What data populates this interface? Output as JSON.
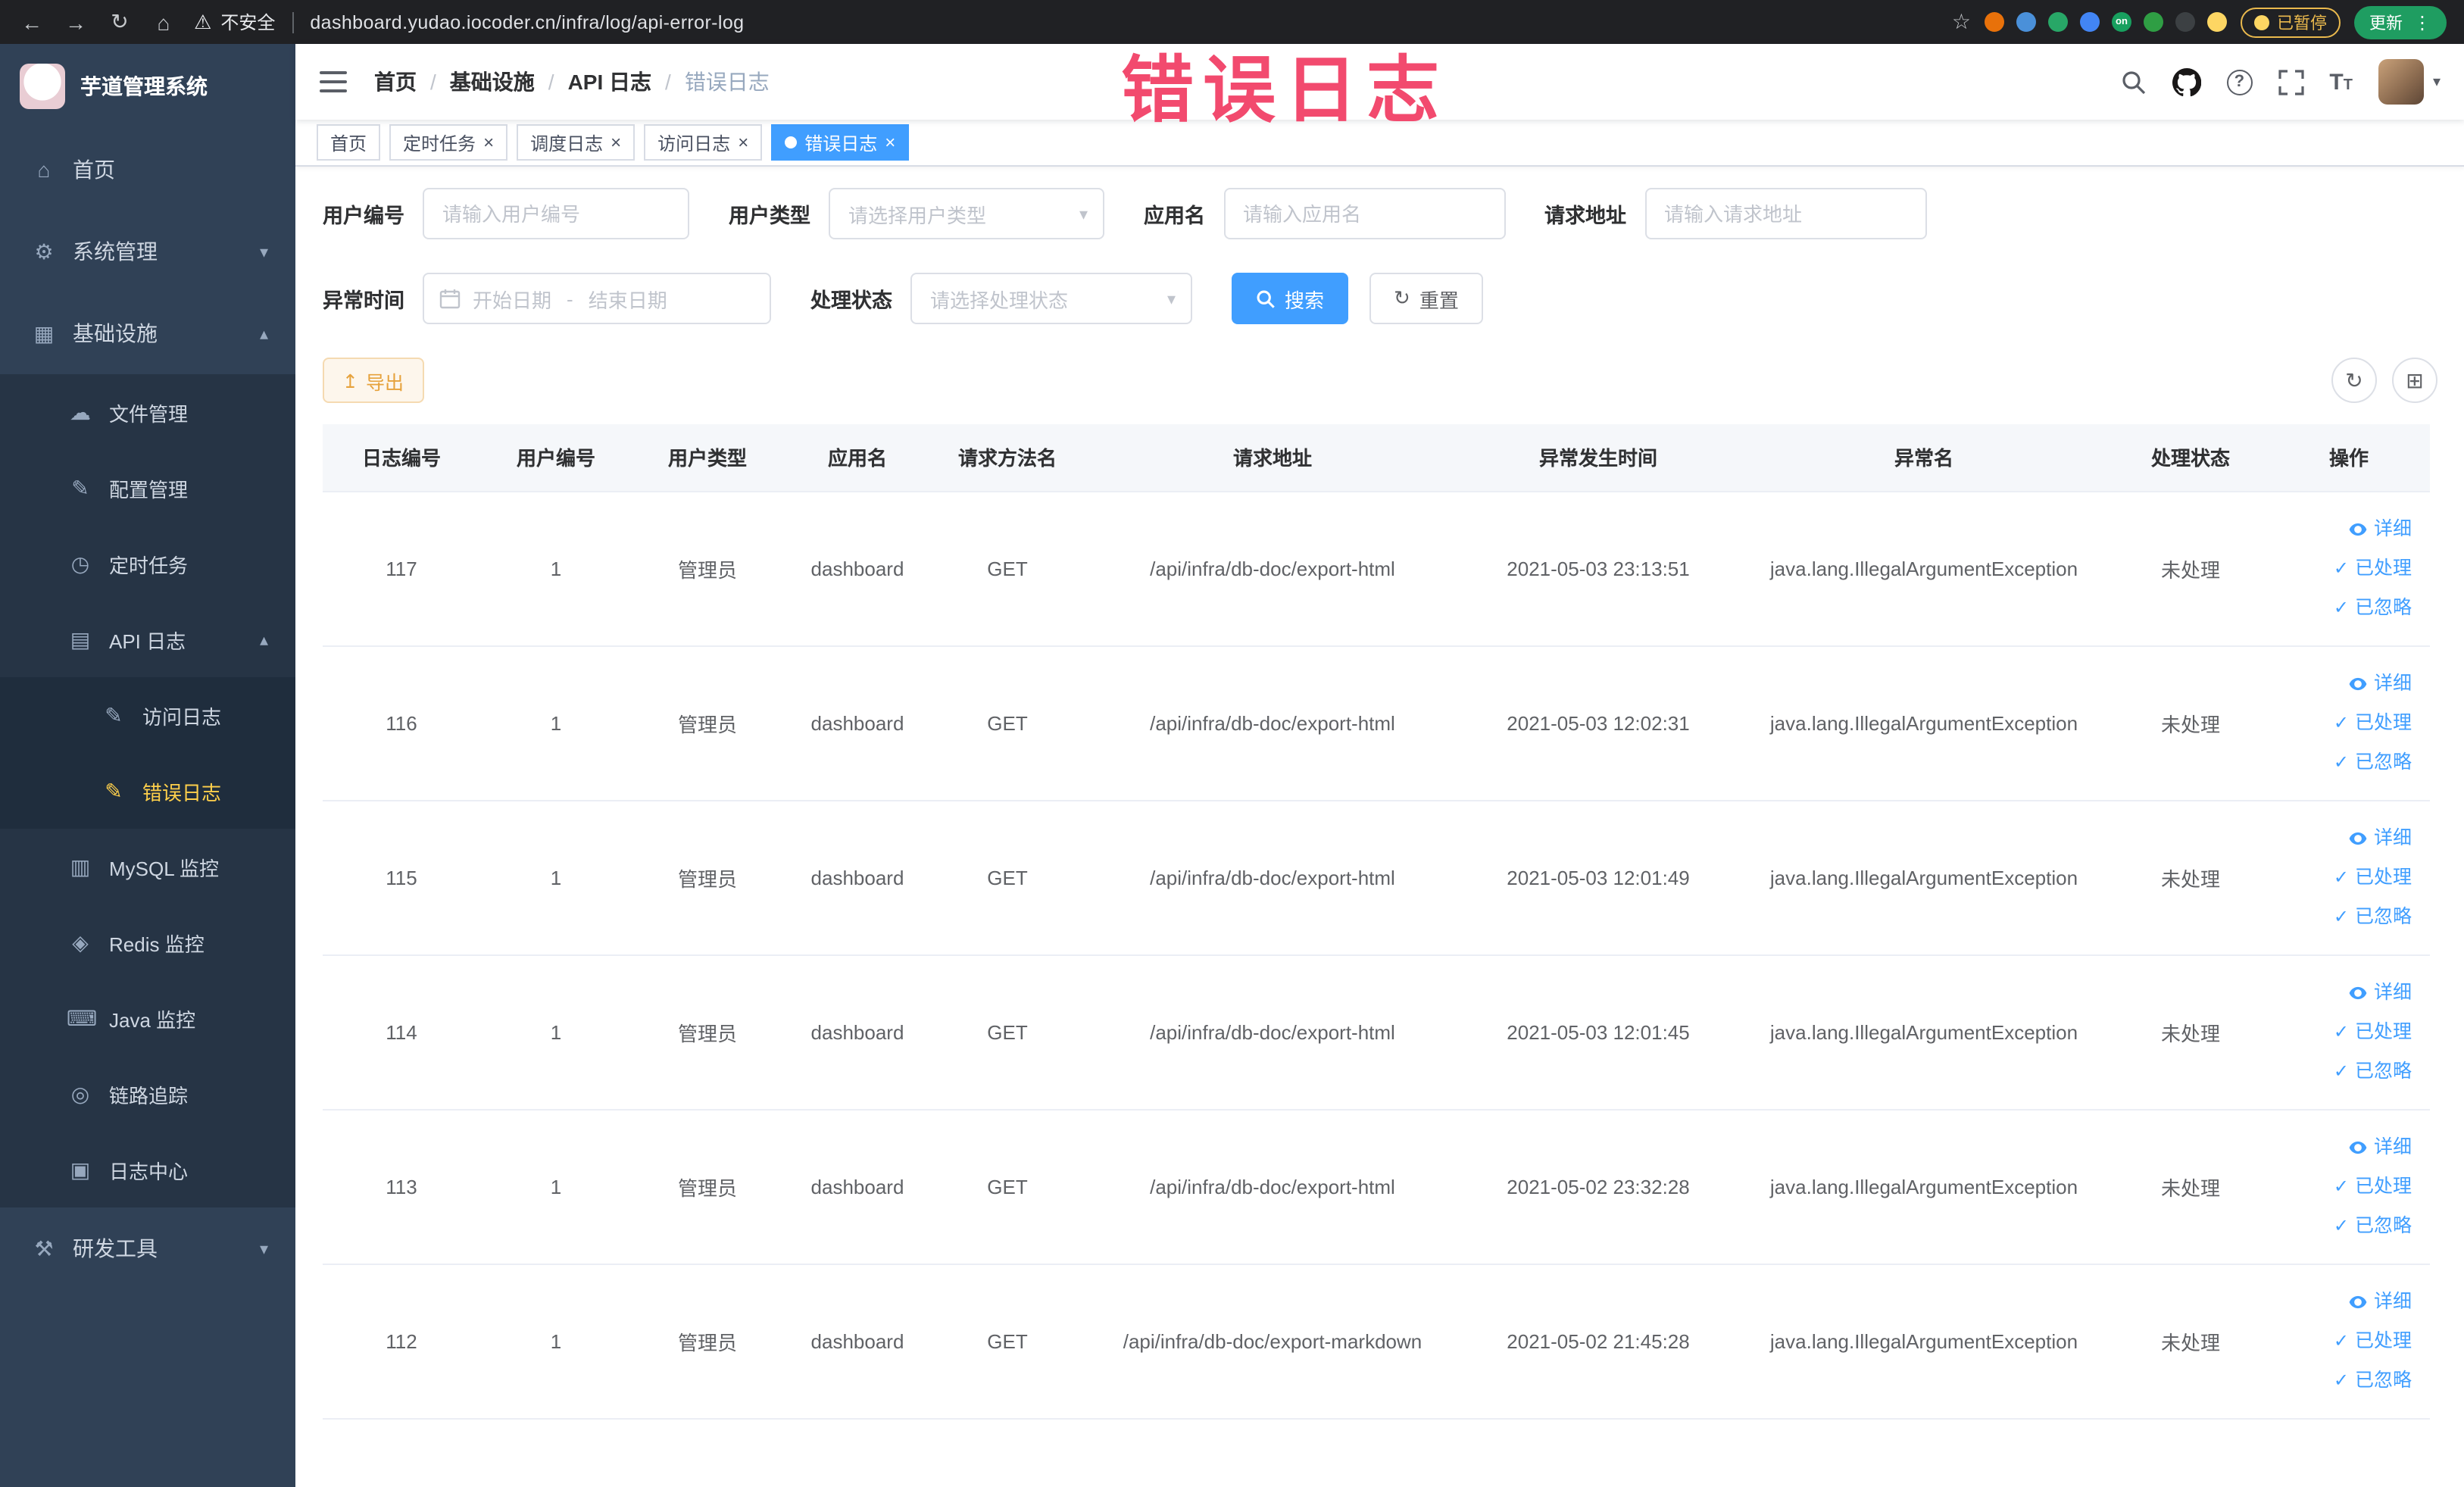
{
  "overlay": {
    "text": "错误日志"
  },
  "colors": {
    "accent": "#409eff",
    "sidebar_bg": "#304156",
    "sidebar_active_text": "#ffd04b",
    "warning_text": "#e6a23c",
    "overlay_text": "#f24a6e",
    "active_tab_bg": "#409eff"
  },
  "browser": {
    "security_label": "不安全",
    "url": "dashboard.yudao.iocoder.cn/infra/log/api-error-log",
    "paused_badge": "已暂停",
    "update_button": "更新",
    "extensions": [
      {
        "name": "extension-icon",
        "color": "#e8710a"
      },
      {
        "name": "extension-icon",
        "color": "#4a90d9"
      },
      {
        "name": "extension-icon",
        "color": "#28a767"
      },
      {
        "name": "extension-icon",
        "color": "#4285f4"
      },
      {
        "name": "extension-icon",
        "color": "#18a05f",
        "label": "on"
      },
      {
        "name": "extension-icon",
        "color": "#2f9e44"
      },
      {
        "name": "extension-icon",
        "color": "#3c4043"
      },
      {
        "name": "profile-icon",
        "color": "#fdd663"
      }
    ]
  },
  "icon_glyphs": {
    "home": "⌂",
    "gear": "⚙",
    "infra": "▦",
    "cloud": "☁",
    "edit": "✎",
    "timer": "◷",
    "doc": "▤",
    "mysql": "▥",
    "redis": "◈",
    "java": "⌨",
    "eye": "◎",
    "log": "▣",
    "tools": "⚒"
  },
  "sidebar": {
    "title": "芋道管理系统",
    "items": [
      {
        "key": "home",
        "label": "首页",
        "icon": "home",
        "level": 0
      },
      {
        "key": "system-mgmt",
        "label": "系统管理",
        "icon": "gear",
        "level": 0,
        "chevron": "down"
      },
      {
        "key": "infrastructure",
        "label": "基础设施",
        "icon": "infra",
        "level": 0,
        "chevron": "up"
      },
      {
        "key": "file-mgmt",
        "label": "文件管理",
        "icon": "cloud",
        "level": 1
      },
      {
        "key": "config-mgmt",
        "label": "配置管理",
        "icon": "edit",
        "level": 1
      },
      {
        "key": "cron-job",
        "label": "定时任务",
        "icon": "timer",
        "level": 1
      },
      {
        "key": "api-log",
        "label": "API 日志",
        "icon": "doc",
        "level": 1,
        "chevron": "up"
      },
      {
        "key": "access-log",
        "label": "访问日志",
        "icon": "edit",
        "level": 2
      },
      {
        "key": "error-log",
        "label": "错误日志",
        "icon": "edit",
        "level": 2,
        "active": true
      },
      {
        "key": "mysql-monitor",
        "label": "MySQL 监控",
        "icon": "mysql",
        "level": 1
      },
      {
        "key": "redis-monitor",
        "label": "Redis 监控",
        "icon": "redis",
        "level": 1
      },
      {
        "key": "java-monitor",
        "label": "Java 监控",
        "icon": "java",
        "level": 1
      },
      {
        "key": "trace",
        "label": "链路追踪",
        "icon": "eye",
        "level": 1
      },
      {
        "key": "log-center",
        "label": "日志中心",
        "icon": "log",
        "level": 1
      },
      {
        "key": "dev-tools",
        "label": "研发工具",
        "icon": "tools",
        "level": 0,
        "chevron": "down"
      }
    ]
  },
  "breadcrumb": {
    "items": [
      {
        "label": "首页"
      },
      {
        "label": "基础设施"
      },
      {
        "label": "API 日志"
      },
      {
        "label": "错误日志",
        "current": true
      }
    ]
  },
  "tabs": {
    "items": [
      {
        "key": "home",
        "label": "首页"
      },
      {
        "key": "cron-job",
        "label": "定时任务",
        "closable": true
      },
      {
        "key": "schedule-log",
        "label": "调度日志",
        "closable": true
      },
      {
        "key": "access-log",
        "label": "访问日志",
        "closable": true
      },
      {
        "key": "error-log",
        "label": "错误日志",
        "closable": true,
        "active": true
      }
    ]
  },
  "filters": {
    "user_id": {
      "label": "用户编号",
      "placeholder": "请输入用户编号"
    },
    "user_type": {
      "label": "用户类型",
      "placeholder": "请选择用户类型"
    },
    "app_name": {
      "label": "应用名",
      "placeholder": "请输入应用名"
    },
    "request_url": {
      "label": "请求地址",
      "placeholder": "请输入请求地址"
    },
    "exception_time": {
      "label": "异常时间",
      "start_placeholder": "开始日期",
      "separator": "-",
      "end_placeholder": "结束日期"
    },
    "process_status": {
      "label": "处理状态",
      "placeholder": "请选择处理状态"
    },
    "search_button": "搜索",
    "reset_button": "重置"
  },
  "toolbar": {
    "export_button": "导出"
  },
  "table": {
    "headers": [
      "日志编号",
      "用户编号",
      "用户类型",
      "应用名",
      "请求方法名",
      "请求地址",
      "异常发生时间",
      "异常名",
      "处理状态",
      "操作"
    ],
    "actions": {
      "detail": "详细",
      "processed": "已处理",
      "ignore": "已忽略"
    },
    "rows": [
      {
        "id": "117",
        "user_id": "1",
        "user_type": "管理员",
        "app": "dashboard",
        "method": "GET",
        "url": "/api/infra/db-doc/export-html",
        "time": "2021-05-03 23:13:51",
        "exception": "java.lang.IllegalArgumentException",
        "status": "未处理"
      },
      {
        "id": "116",
        "user_id": "1",
        "user_type": "管理员",
        "app": "dashboard",
        "method": "GET",
        "url": "/api/infra/db-doc/export-html",
        "time": "2021-05-03 12:02:31",
        "exception": "java.lang.IllegalArgumentException",
        "status": "未处理"
      },
      {
        "id": "115",
        "user_id": "1",
        "user_type": "管理员",
        "app": "dashboard",
        "method": "GET",
        "url": "/api/infra/db-doc/export-html",
        "time": "2021-05-03 12:01:49",
        "exception": "java.lang.IllegalArgumentException",
        "status": "未处理"
      },
      {
        "id": "114",
        "user_id": "1",
        "user_type": "管理员",
        "app": "dashboard",
        "method": "GET",
        "url": "/api/infra/db-doc/export-html",
        "time": "2021-05-03 12:01:45",
        "exception": "java.lang.IllegalArgumentException",
        "status": "未处理"
      },
      {
        "id": "113",
        "user_id": "1",
        "user_type": "管理员",
        "app": "dashboard",
        "method": "GET",
        "url": "/api/infra/db-doc/export-html",
        "time": "2021-05-02 23:32:28",
        "exception": "java.lang.IllegalArgumentException",
        "status": "未处理"
      },
      {
        "id": "112",
        "user_id": "1",
        "user_type": "管理员",
        "app": "dashboard",
        "method": "GET",
        "url": "/api/infra/db-doc/export-markdown",
        "time": "2021-05-02 21:45:28",
        "exception": "java.lang.IllegalArgumentException",
        "status": "未处理"
      }
    ]
  }
}
